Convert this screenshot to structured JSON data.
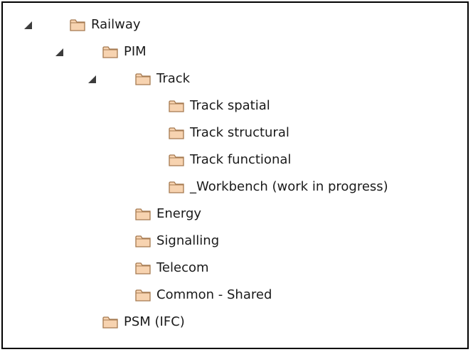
{
  "tree": {
    "items": [
      {
        "label": "Railway",
        "expanded": true,
        "has_children": true,
        "icon": "folder-icon"
      },
      {
        "label": "PIM",
        "expanded": true,
        "has_children": true,
        "icon": "folder-icon"
      },
      {
        "label": "Track",
        "expanded": true,
        "has_children": true,
        "icon": "folder-icon"
      },
      {
        "label": "Track spatial",
        "has_children": false,
        "icon": "folder-icon"
      },
      {
        "label": "Track structural",
        "has_children": false,
        "icon": "folder-icon"
      },
      {
        "label": "Track functional",
        "has_children": false,
        "icon": "folder-icon"
      },
      {
        "label": "_Workbench (work in progress)",
        "has_children": false,
        "icon": "folder-icon"
      },
      {
        "label": "Energy",
        "has_children": false,
        "icon": "folder-icon"
      },
      {
        "label": "Signalling",
        "has_children": false,
        "icon": "folder-icon"
      },
      {
        "label": "Telecom",
        "has_children": false,
        "icon": "folder-icon"
      },
      {
        "label": "Common - Shared",
        "has_children": false,
        "icon": "folder-icon"
      },
      {
        "label": "PSM (IFC)",
        "has_children": false,
        "icon": "folder-icon"
      }
    ]
  },
  "colors": {
    "folder_fill": "#f7d3b0",
    "folder_stroke": "#a5794f",
    "expander": "#3c3c3c",
    "border": "#000000"
  }
}
